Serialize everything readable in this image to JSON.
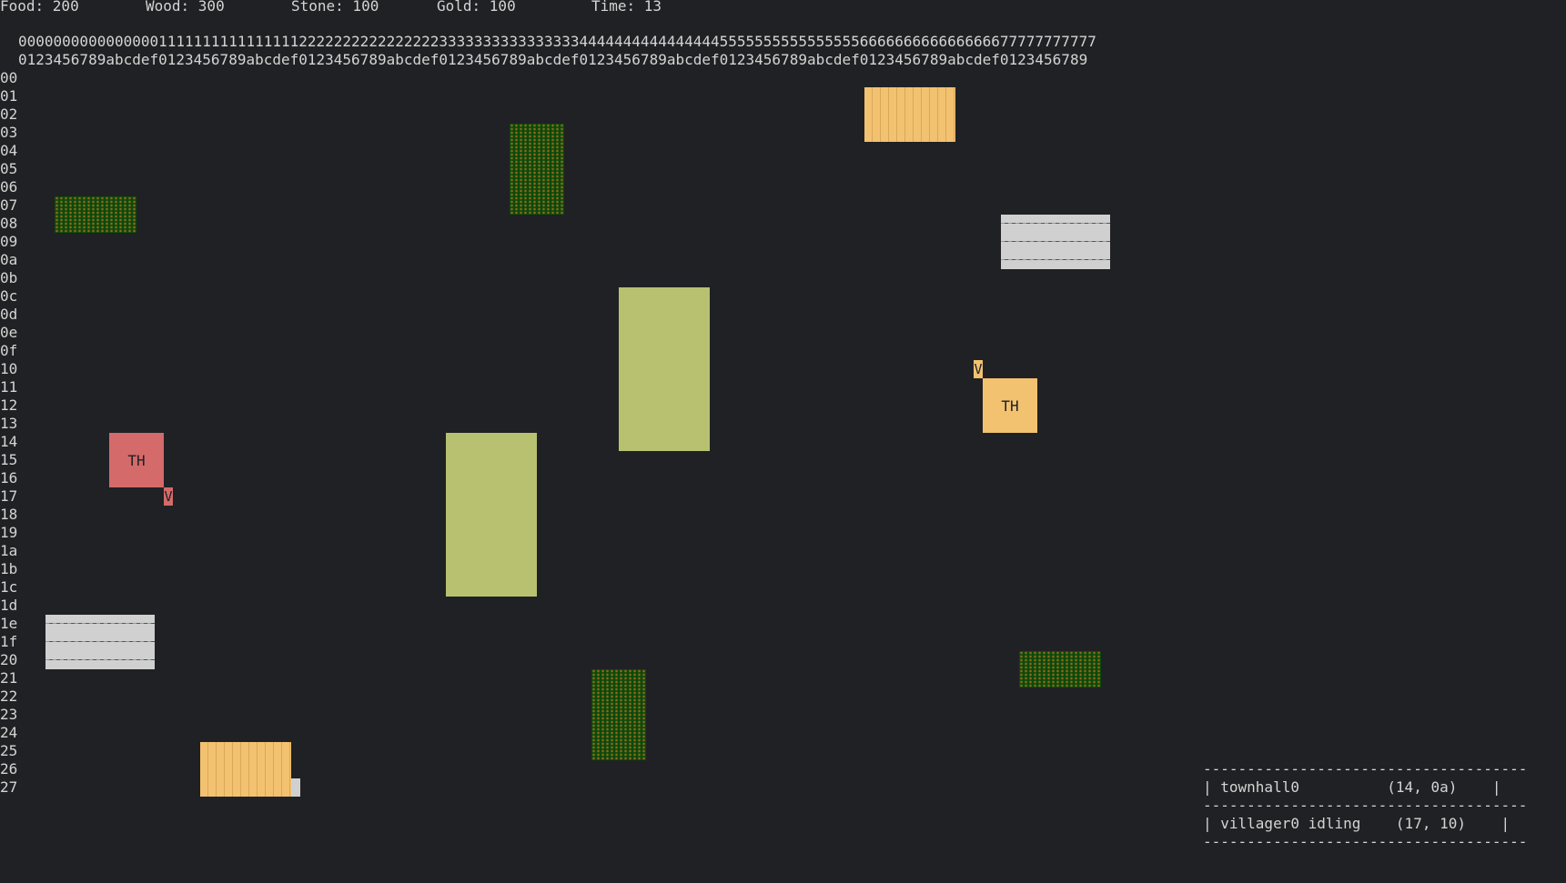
{
  "resources": {
    "food": "Food: 200",
    "wood": "Wood: 300",
    "stone": "Stone: 100",
    "gold": "Gold: 100",
    "time": "Time: 13"
  },
  "grid": {
    "col_header_1": "000000000000000011111111111111112222222222222222333333333333333344444444444444445555555555555555666666666666666677777777777",
    "col_header_2": "0123456789abcdef0123456789abcdef0123456789abcdef0123456789abcdef0123456789abcdef0123456789abcdef0123456789abcdef0123456789",
    "rows": [
      "00",
      "01",
      "02",
      "03",
      "04",
      "05",
      "06",
      "07",
      "08",
      "09",
      "0a",
      "0b",
      "0c",
      "0d",
      "0e",
      "0f",
      "10",
      "11",
      "12",
      "13",
      "14",
      "15",
      "16",
      "17",
      "18",
      "19",
      "1a",
      "1b",
      "1c",
      "1d",
      "1e",
      "1f",
      "20",
      "21",
      "22",
      "23",
      "24",
      "25",
      "26",
      "27"
    ]
  },
  "units": {
    "townhall_label": "TH",
    "villager_label": "V"
  },
  "info_panel": {
    "border": "-------------------------------------",
    "row1": "| townhall0          (14, 0a)    |",
    "row2": "| villager0 idling    (17, 10)    |"
  },
  "colors": {
    "background": "#202124",
    "player_red": "#d46a6a",
    "player_orange": "#f2c270",
    "tree": "#0c4a0c",
    "field": "#b8c170",
    "stone": "#d0d0d0"
  }
}
